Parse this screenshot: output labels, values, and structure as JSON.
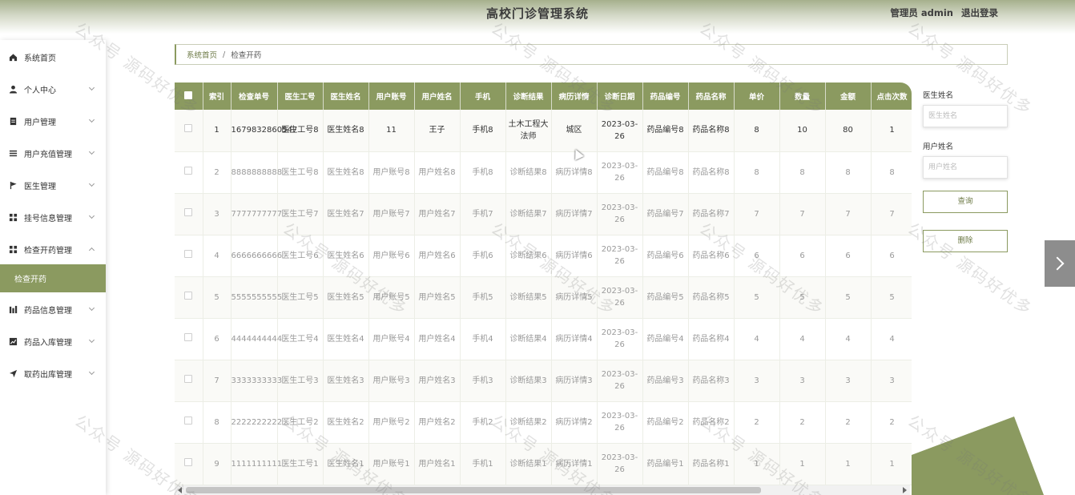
{
  "app": {
    "title": "高校门诊管理系统"
  },
  "user": {
    "role_name": "管理员 admin",
    "logout": "退出登录"
  },
  "sidebar": {
    "items": [
      {
        "label": "系统首页",
        "icon": "home-icon"
      },
      {
        "label": "个人中心",
        "icon": "user-icon"
      },
      {
        "label": "用户管理",
        "icon": "document-icon"
      },
      {
        "label": "用户充值管理",
        "icon": "list-icon"
      },
      {
        "label": "医生管理",
        "icon": "flag-icon"
      },
      {
        "label": "挂号信息管理",
        "icon": "grid-icon"
      },
      {
        "label": "检查开药管理",
        "icon": "grid-icon"
      },
      {
        "label": "药品信息管理",
        "icon": "bar-icon"
      },
      {
        "label": "药品入库管理",
        "icon": "chart-icon"
      },
      {
        "label": "取药出库管理",
        "icon": "send-icon"
      }
    ],
    "active_sub": "检查开药"
  },
  "breadcrumb": {
    "home": "系统首页",
    "separator": "/",
    "current": "检查开药"
  },
  "table": {
    "headers": [
      "索引",
      "检查单号",
      "医生工号",
      "医生姓名",
      "用户账号",
      "用户姓名",
      "手机",
      "诊断结果",
      "病历详情",
      "诊断日期",
      "药品编号",
      "药品名称",
      "单价",
      "数量",
      "金额",
      "点击次数"
    ],
    "rows": [
      [
        "1",
        "1679832860547",
        "医生工号8",
        "医生姓名8",
        "11",
        "王子",
        "手机8",
        "土木工程大法师",
        "城区",
        "2023-03-26",
        "药品编号8",
        "药品名称8",
        "8",
        "10",
        "80",
        "1"
      ],
      [
        "2",
        "8888888888",
        "医生工号8",
        "医生姓名8",
        "用户账号8",
        "用户姓名8",
        "手机8",
        "诊断结果8",
        "病历详情8",
        "2023-03-26",
        "药品编号8",
        "药品名称8",
        "8",
        "8",
        "8",
        "8"
      ],
      [
        "3",
        "7777777777",
        "医生工号7",
        "医生姓名7",
        "用户账号7",
        "用户姓名7",
        "手机7",
        "诊断结果7",
        "病历详情7",
        "2023-03-26",
        "药品编号7",
        "药品名称7",
        "7",
        "7",
        "7",
        "7"
      ],
      [
        "4",
        "6666666666",
        "医生工号6",
        "医生姓名6",
        "用户账号6",
        "用户姓名6",
        "手机6",
        "诊断结果6",
        "病历详情6",
        "2023-03-26",
        "药品编号6",
        "药品名称6",
        "6",
        "6",
        "6",
        "6"
      ],
      [
        "5",
        "5555555555",
        "医生工号5",
        "医生姓名5",
        "用户账号5",
        "用户姓名5",
        "手机5",
        "诊断结果5",
        "病历详情5",
        "2023-03-26",
        "药品编号5",
        "药品名称5",
        "5",
        "5",
        "5",
        "5"
      ],
      [
        "6",
        "4444444444",
        "医生工号4",
        "医生姓名4",
        "用户账号4",
        "用户姓名4",
        "手机4",
        "诊断结果4",
        "病历详情4",
        "2023-03-26",
        "药品编号4",
        "药品名称4",
        "4",
        "4",
        "4",
        "4"
      ],
      [
        "7",
        "3333333333",
        "医生工号3",
        "医生姓名3",
        "用户账号3",
        "用户姓名3",
        "手机3",
        "诊断结果3",
        "病历详情3",
        "2023-03-26",
        "药品编号3",
        "药品名称3",
        "3",
        "3",
        "3",
        "3"
      ],
      [
        "8",
        "2222222222",
        "医生工号2",
        "医生姓名2",
        "用户账号2",
        "用户姓名2",
        "手机2",
        "诊断结果2",
        "病历详情2",
        "2023-03-26",
        "药品编号2",
        "药品名称2",
        "2",
        "2",
        "2",
        "2"
      ],
      [
        "9",
        "1111111111",
        "医生工号1",
        "医生姓名1",
        "用户账号1",
        "用户姓名1",
        "手机1",
        "诊断结果1",
        "病历详情1",
        "2023-03-26",
        "药品编号1",
        "药品名称1",
        "1",
        "1",
        "1",
        "1"
      ]
    ]
  },
  "search": {
    "doctor_label": "医生姓名",
    "doctor_placeholder": "医生姓名",
    "user_label": "用户姓名",
    "user_placeholder": "用户姓名",
    "query_button": "查询",
    "delete_button": "删除"
  },
  "watermark": "公众号 源码好优多",
  "colors": {
    "accent": "#8b9a60",
    "header_gradient_top": "#a6b08d"
  }
}
